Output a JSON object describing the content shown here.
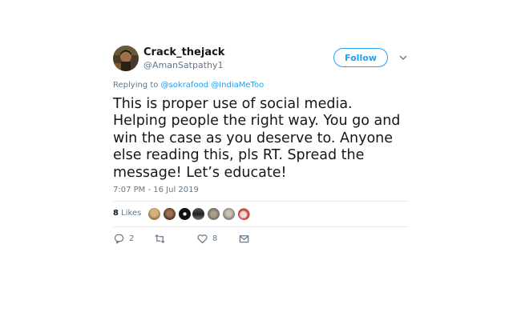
{
  "author": {
    "display_name": "Crack_thejack",
    "handle": "@AmanSatpathy1"
  },
  "follow_button": {
    "label": "Follow"
  },
  "reply_context": {
    "prefix": "Replying to",
    "mentions": [
      "@sokrafood",
      "@IndiaMeToo"
    ]
  },
  "tweet": {
    "text": "This is proper use of social media. Helping people the right way. You go and win the case as you deserve to. Anyone else reading this, pls RT. Spread the message! Let’s educate!",
    "timestamp": "7:07 PM - 16 Jul 2019"
  },
  "likes": {
    "count": "8",
    "label": "Likes",
    "liker_avatars": [
      "liker-avatar-1",
      "liker-avatar-2",
      "liker-avatar-3",
      "liker-avatar-4",
      "liker-avatar-5",
      "liker-avatar-6",
      "liker-avatar-7",
      "liker-avatar-8"
    ]
  },
  "actions": {
    "reply": {
      "icon": "reply-icon",
      "count": "2"
    },
    "retweet": {
      "icon": "retweet-icon",
      "count": ""
    },
    "like": {
      "icon": "heart-icon",
      "count": "8"
    },
    "message": {
      "icon": "envelope-icon"
    }
  },
  "colors": {
    "accent": "#1da1f2",
    "secondary_text": "#657786",
    "primary_text": "#14171a",
    "divider": "#e6ecf0"
  }
}
